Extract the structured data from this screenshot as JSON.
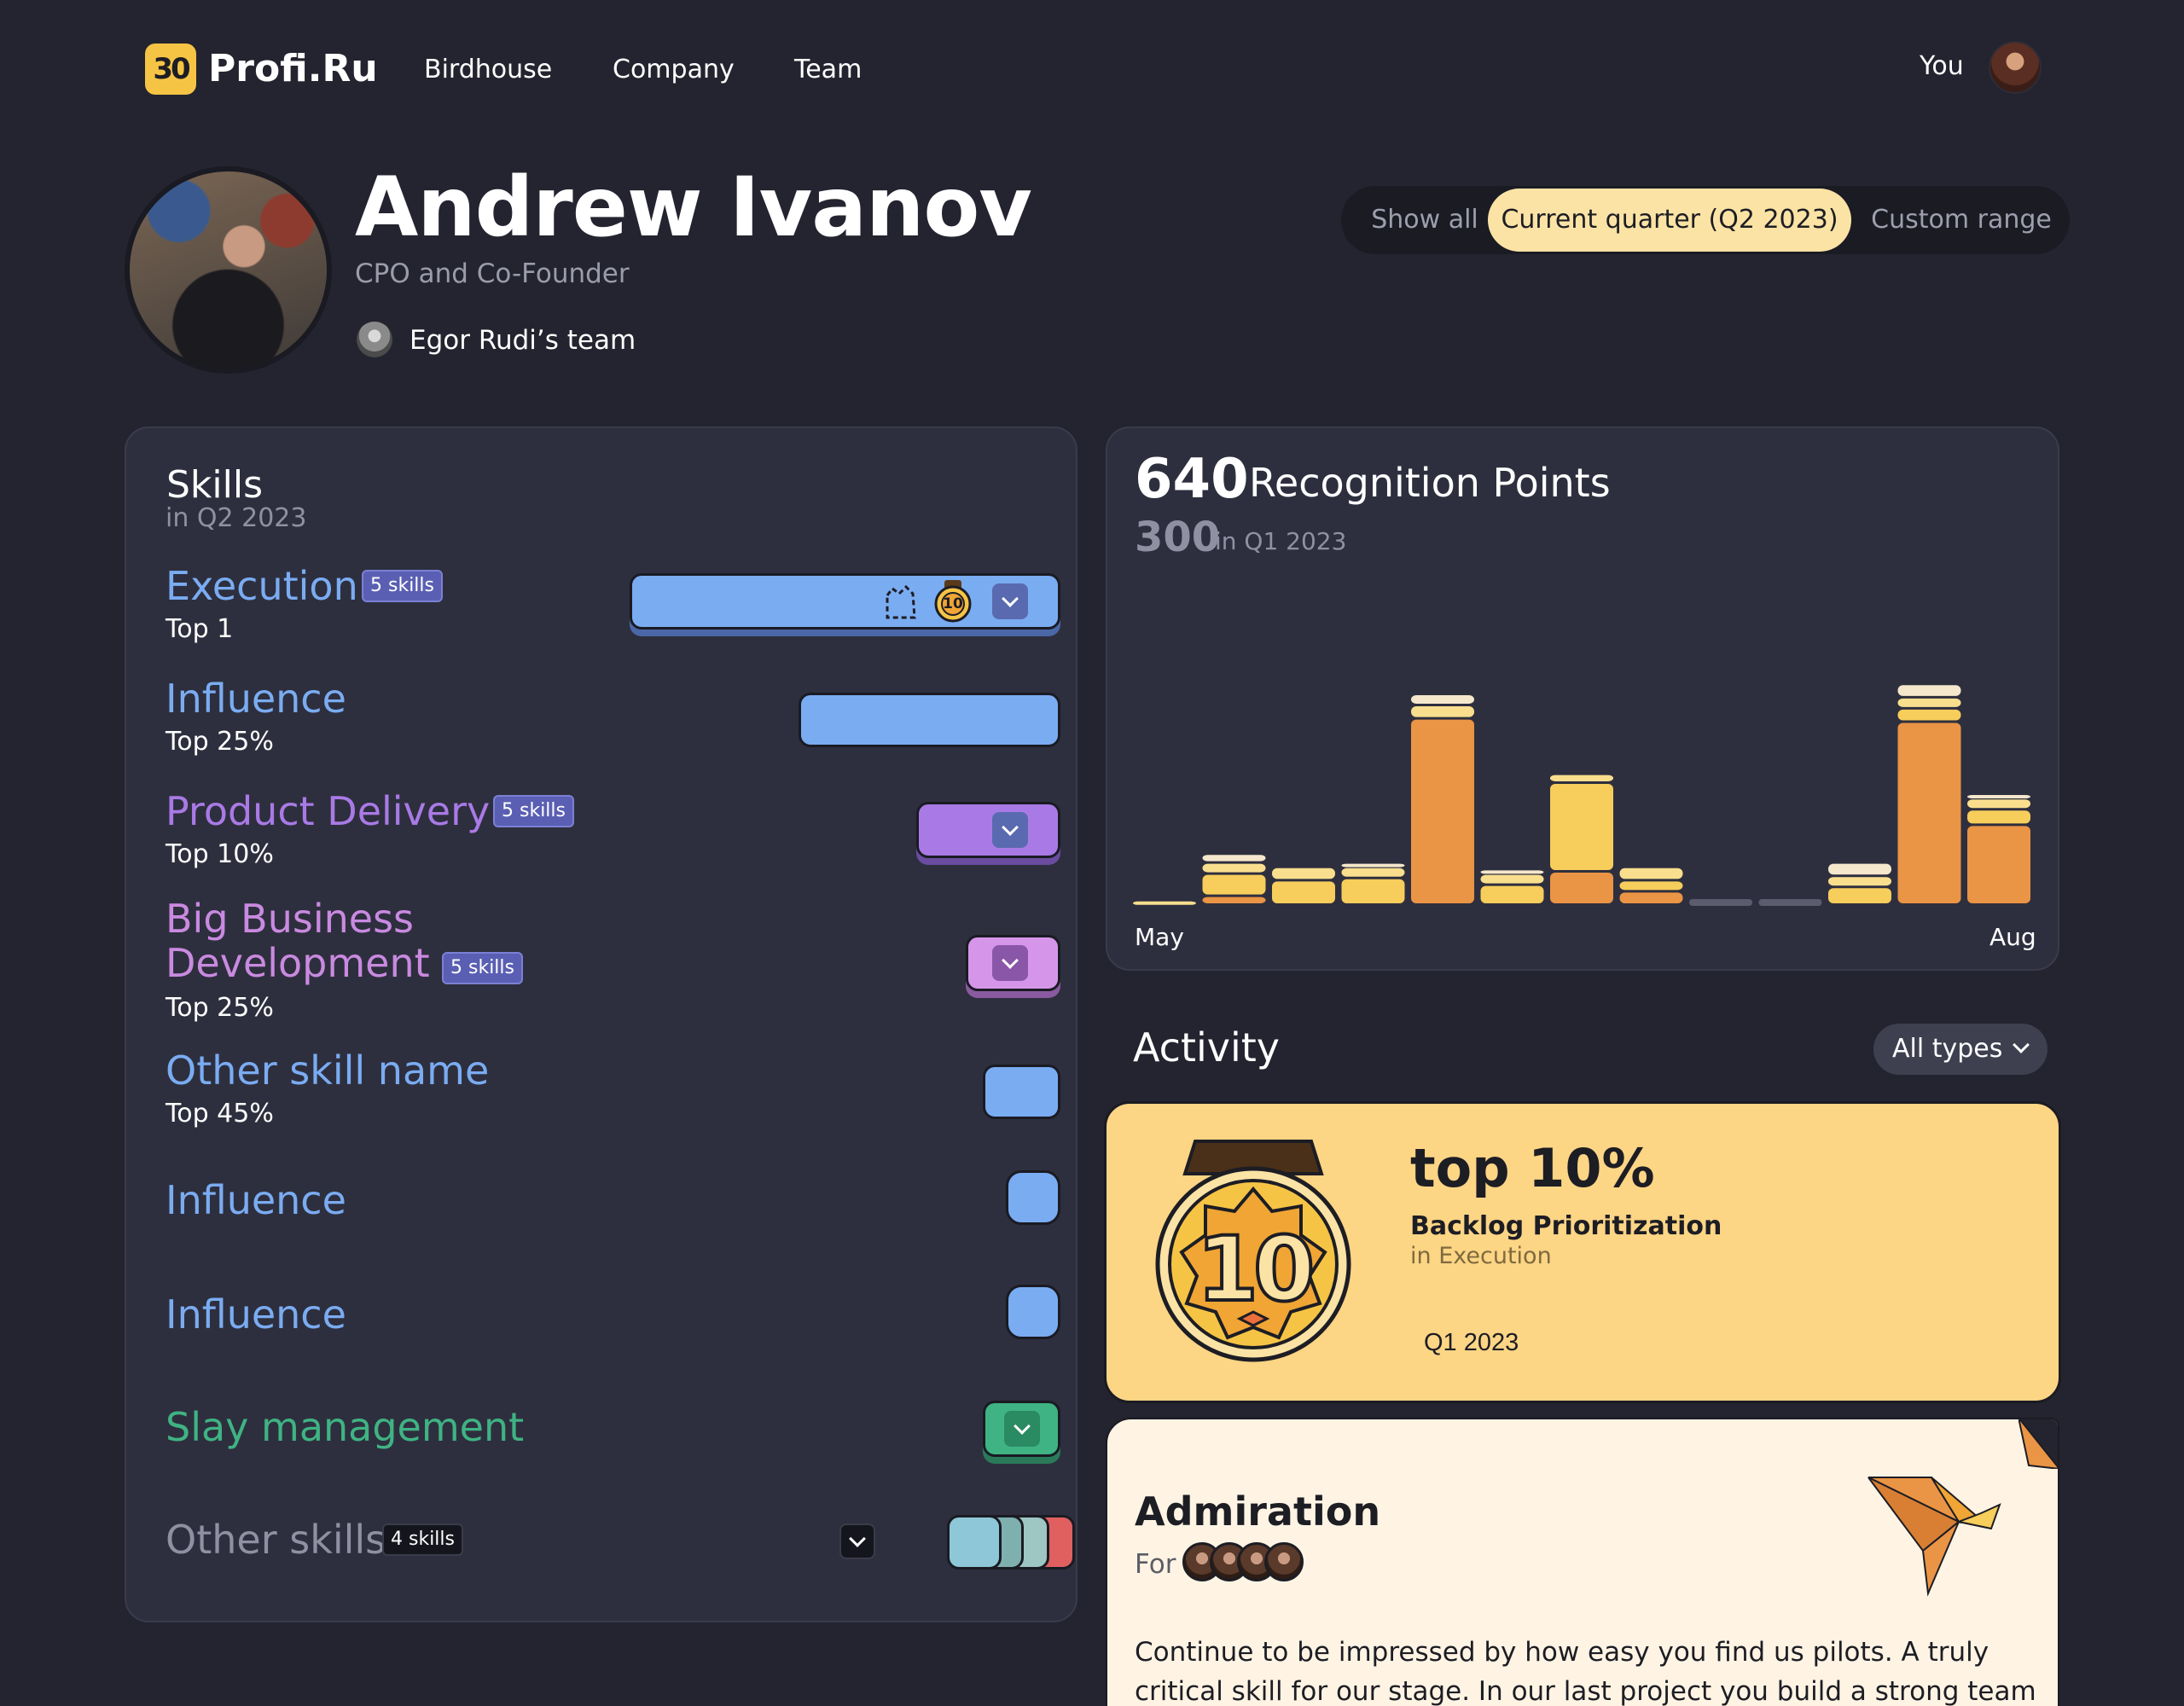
{
  "nav": {
    "logo_badge": "30",
    "logo_text": "Profi.Ru",
    "links": [
      "Birdhouse",
      "Company",
      "Team"
    ],
    "user_label": "You"
  },
  "profile": {
    "name": "Andrew Ivanov",
    "role": "CPO and Co-Founder",
    "team": "Egor Rudi’s team"
  },
  "range_toggle": {
    "options": [
      "Show all",
      "Current quarter (Q2 2023)",
      "Custom range"
    ],
    "selected": "Current quarter (Q2 2023)"
  },
  "skills": {
    "title": "Skills",
    "subtitle": "in Q2 2023",
    "items": [
      {
        "name": "Execution",
        "badge": "5 skills",
        "top": "Top 1",
        "color": "#7aacf2"
      },
      {
        "name": "Influence",
        "badge": "",
        "top": "Top 25%",
        "color": "#7aacf2"
      },
      {
        "name": "Product Delivery",
        "badge": "5 skills",
        "top": "Top 10%",
        "color": "#a97ae6"
      },
      {
        "name_line1": "Big Business",
        "name_line2": "Development",
        "badge": "5 skills",
        "top": "Top 25%",
        "color": "#c98ae0"
      },
      {
        "name": "Other skill name",
        "badge": "",
        "top": "Top 45%",
        "color": "#7aacf2"
      },
      {
        "name": "Influence",
        "badge": "",
        "top": "",
        "color": "#7aacf2"
      },
      {
        "name": "Influence",
        "badge": "",
        "top": "",
        "color": "#7aacf2"
      },
      {
        "name": "Slay management",
        "badge": "",
        "top": "",
        "color": "#3fb383"
      },
      {
        "name": "Other skills",
        "badge": "4 skills",
        "top": "",
        "color": "#8f91a2"
      }
    ],
    "execution_medal": "10"
  },
  "recognition": {
    "points": "640",
    "label": "Recognition Points",
    "prev_points": "300",
    "prev_label": "in Q1 2023",
    "x_start": "May",
    "x_end": "Aug",
    "colors": {
      "orange": "#ea9445",
      "yellow": "#f7cd5b",
      "light": "#f9de8e",
      "pale": "#f5e7cc",
      "empty": "#5b5d6e"
    }
  },
  "chart_data": {
    "type": "bar",
    "stacked": true,
    "x_start_label": "May",
    "x_end_label": "Aug",
    "series": [
      {
        "values": [
          0,
          8,
          0,
          0,
          168,
          0,
          30,
          12,
          0,
          0,
          0,
          165,
          72
        ]
      },
      {
        "values": [
          0,
          20,
          22,
          24,
          0,
          18,
          80,
          10,
          0,
          0,
          16,
          12,
          14
        ]
      },
      {
        "values": [
          4,
          10,
          12,
          10,
          12,
          10,
          8,
          12,
          0,
          0,
          10,
          10,
          10
        ]
      },
      {
        "values": [
          0,
          8,
          0,
          4,
          10,
          4,
          0,
          0,
          0,
          0,
          12,
          12,
          4
        ]
      }
    ]
  },
  "activity": {
    "title": "Activity",
    "filter": "All types",
    "award": {
      "headline": "top 10%",
      "name": "Backlog Prioritization",
      "category": "in Execution",
      "quarter": "Q1 2023",
      "medal_number": "10"
    },
    "admiration": {
      "title": "Admiration",
      "for_label": "For",
      "text": "Continue to be impressed by how easy you find us pilots. A truly critical skill for our stage. In our last project you build a strong team and give us"
    }
  }
}
